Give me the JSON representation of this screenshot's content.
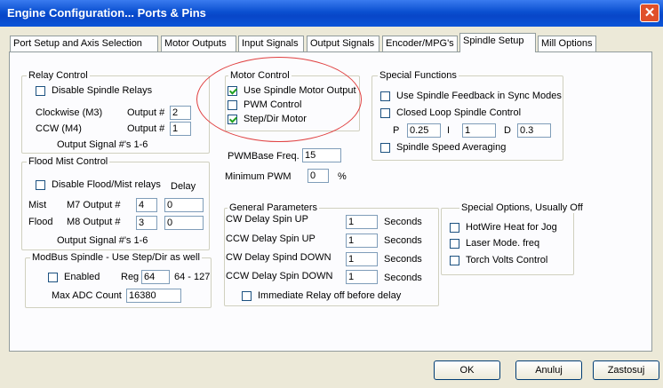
{
  "window": {
    "title": "Engine Configuration... Ports & Pins",
    "close_glyph": "✕"
  },
  "tabs": [
    {
      "label": "Port Setup and Axis Selection"
    },
    {
      "label": "Motor Outputs"
    },
    {
      "label": "Input Signals"
    },
    {
      "label": "Output Signals"
    },
    {
      "label": "Encoder/MPG's"
    },
    {
      "label": "Spindle Setup",
      "active": true
    },
    {
      "label": "Mill Options"
    }
  ],
  "relay": {
    "title": "Relay Control",
    "disable_label": "Disable Spindle Relays",
    "disable_checked": false,
    "cw_label": "Clockwise (M3)",
    "cw_output_label": "Output #",
    "cw_value": "2",
    "ccw_label": "CCW (M4)",
    "ccw_output_label": "Output #",
    "ccw_value": "1",
    "note": "Output Signal #'s 1-6"
  },
  "flood": {
    "title": "Flood Mist Control",
    "disable_label": "Disable Flood/Mist relays",
    "disable_checked": false,
    "delay_label": "Delay",
    "mist_label": "Mist",
    "m7_label": "M7 Output #",
    "m7_value": "4",
    "m7_delay": "0",
    "flood_label": "Flood",
    "m8_label": "M8 Output #",
    "m8_value": "3",
    "m8_delay": "0",
    "note": "Output Signal #'s 1-6"
  },
  "modbus": {
    "title": "ModBus Spindle - Use Step/Dir as well",
    "enabled_label": "Enabled",
    "enabled_checked": false,
    "reg_label": "Reg",
    "reg_value": "64",
    "reg_range": "64 - 127",
    "max_adc_label": "Max ADC Count",
    "max_adc_value": "16380"
  },
  "motor": {
    "title": "Motor Control",
    "use_output_label": "Use Spindle Motor Output",
    "use_output_checked": true,
    "pwm_label": "PWM Control",
    "pwm_checked": false,
    "stepdir_label": "Step/Dir Motor",
    "stepdir_checked": true,
    "pwm_base_label": "PWMBase Freq.",
    "pwm_base_value": "15",
    "min_pwm_label": "Minimum PWM",
    "min_pwm_value": "0",
    "min_pwm_unit": "%"
  },
  "special": {
    "title": "Special Functions",
    "feedback_label": "Use Spindle Feedback in Sync Modes",
    "feedback_checked": false,
    "closed_loop_label": "Closed Loop Spindle Control",
    "closed_loop_checked": false,
    "p_label": "P",
    "p_value": "0.25",
    "i_label": "I",
    "i_value": "1",
    "d_label": "D",
    "d_value": "0.3",
    "averaging_label": "Spindle Speed Averaging",
    "averaging_checked": false
  },
  "general": {
    "title": "General Parameters",
    "rows": [
      {
        "label": "CW Delay Spin UP",
        "value": "1",
        "unit": "Seconds"
      },
      {
        "label": "CCW Delay Spin UP",
        "value": "1",
        "unit": "Seconds"
      },
      {
        "label": "CW Delay Spind DOWN",
        "value": "1",
        "unit": "Seconds"
      },
      {
        "label": "CCW Delay Spin DOWN",
        "value": "1",
        "unit": "Seconds"
      }
    ],
    "immediate_label": "Immediate Relay off before delay",
    "immediate_checked": false
  },
  "options": {
    "title": "Special Options, Usually Off",
    "hotwire_label": "HotWire Heat for Jog",
    "laser_label": "Laser Mode. freq",
    "torch_label": "Torch Volts Control"
  },
  "buttons": {
    "ok": "OK",
    "cancel": "Anuluj",
    "apply": "Zastosuj"
  },
  "colors": {
    "annotation_ellipse": "#e04040",
    "titlebar": "#0a4fd0"
  }
}
